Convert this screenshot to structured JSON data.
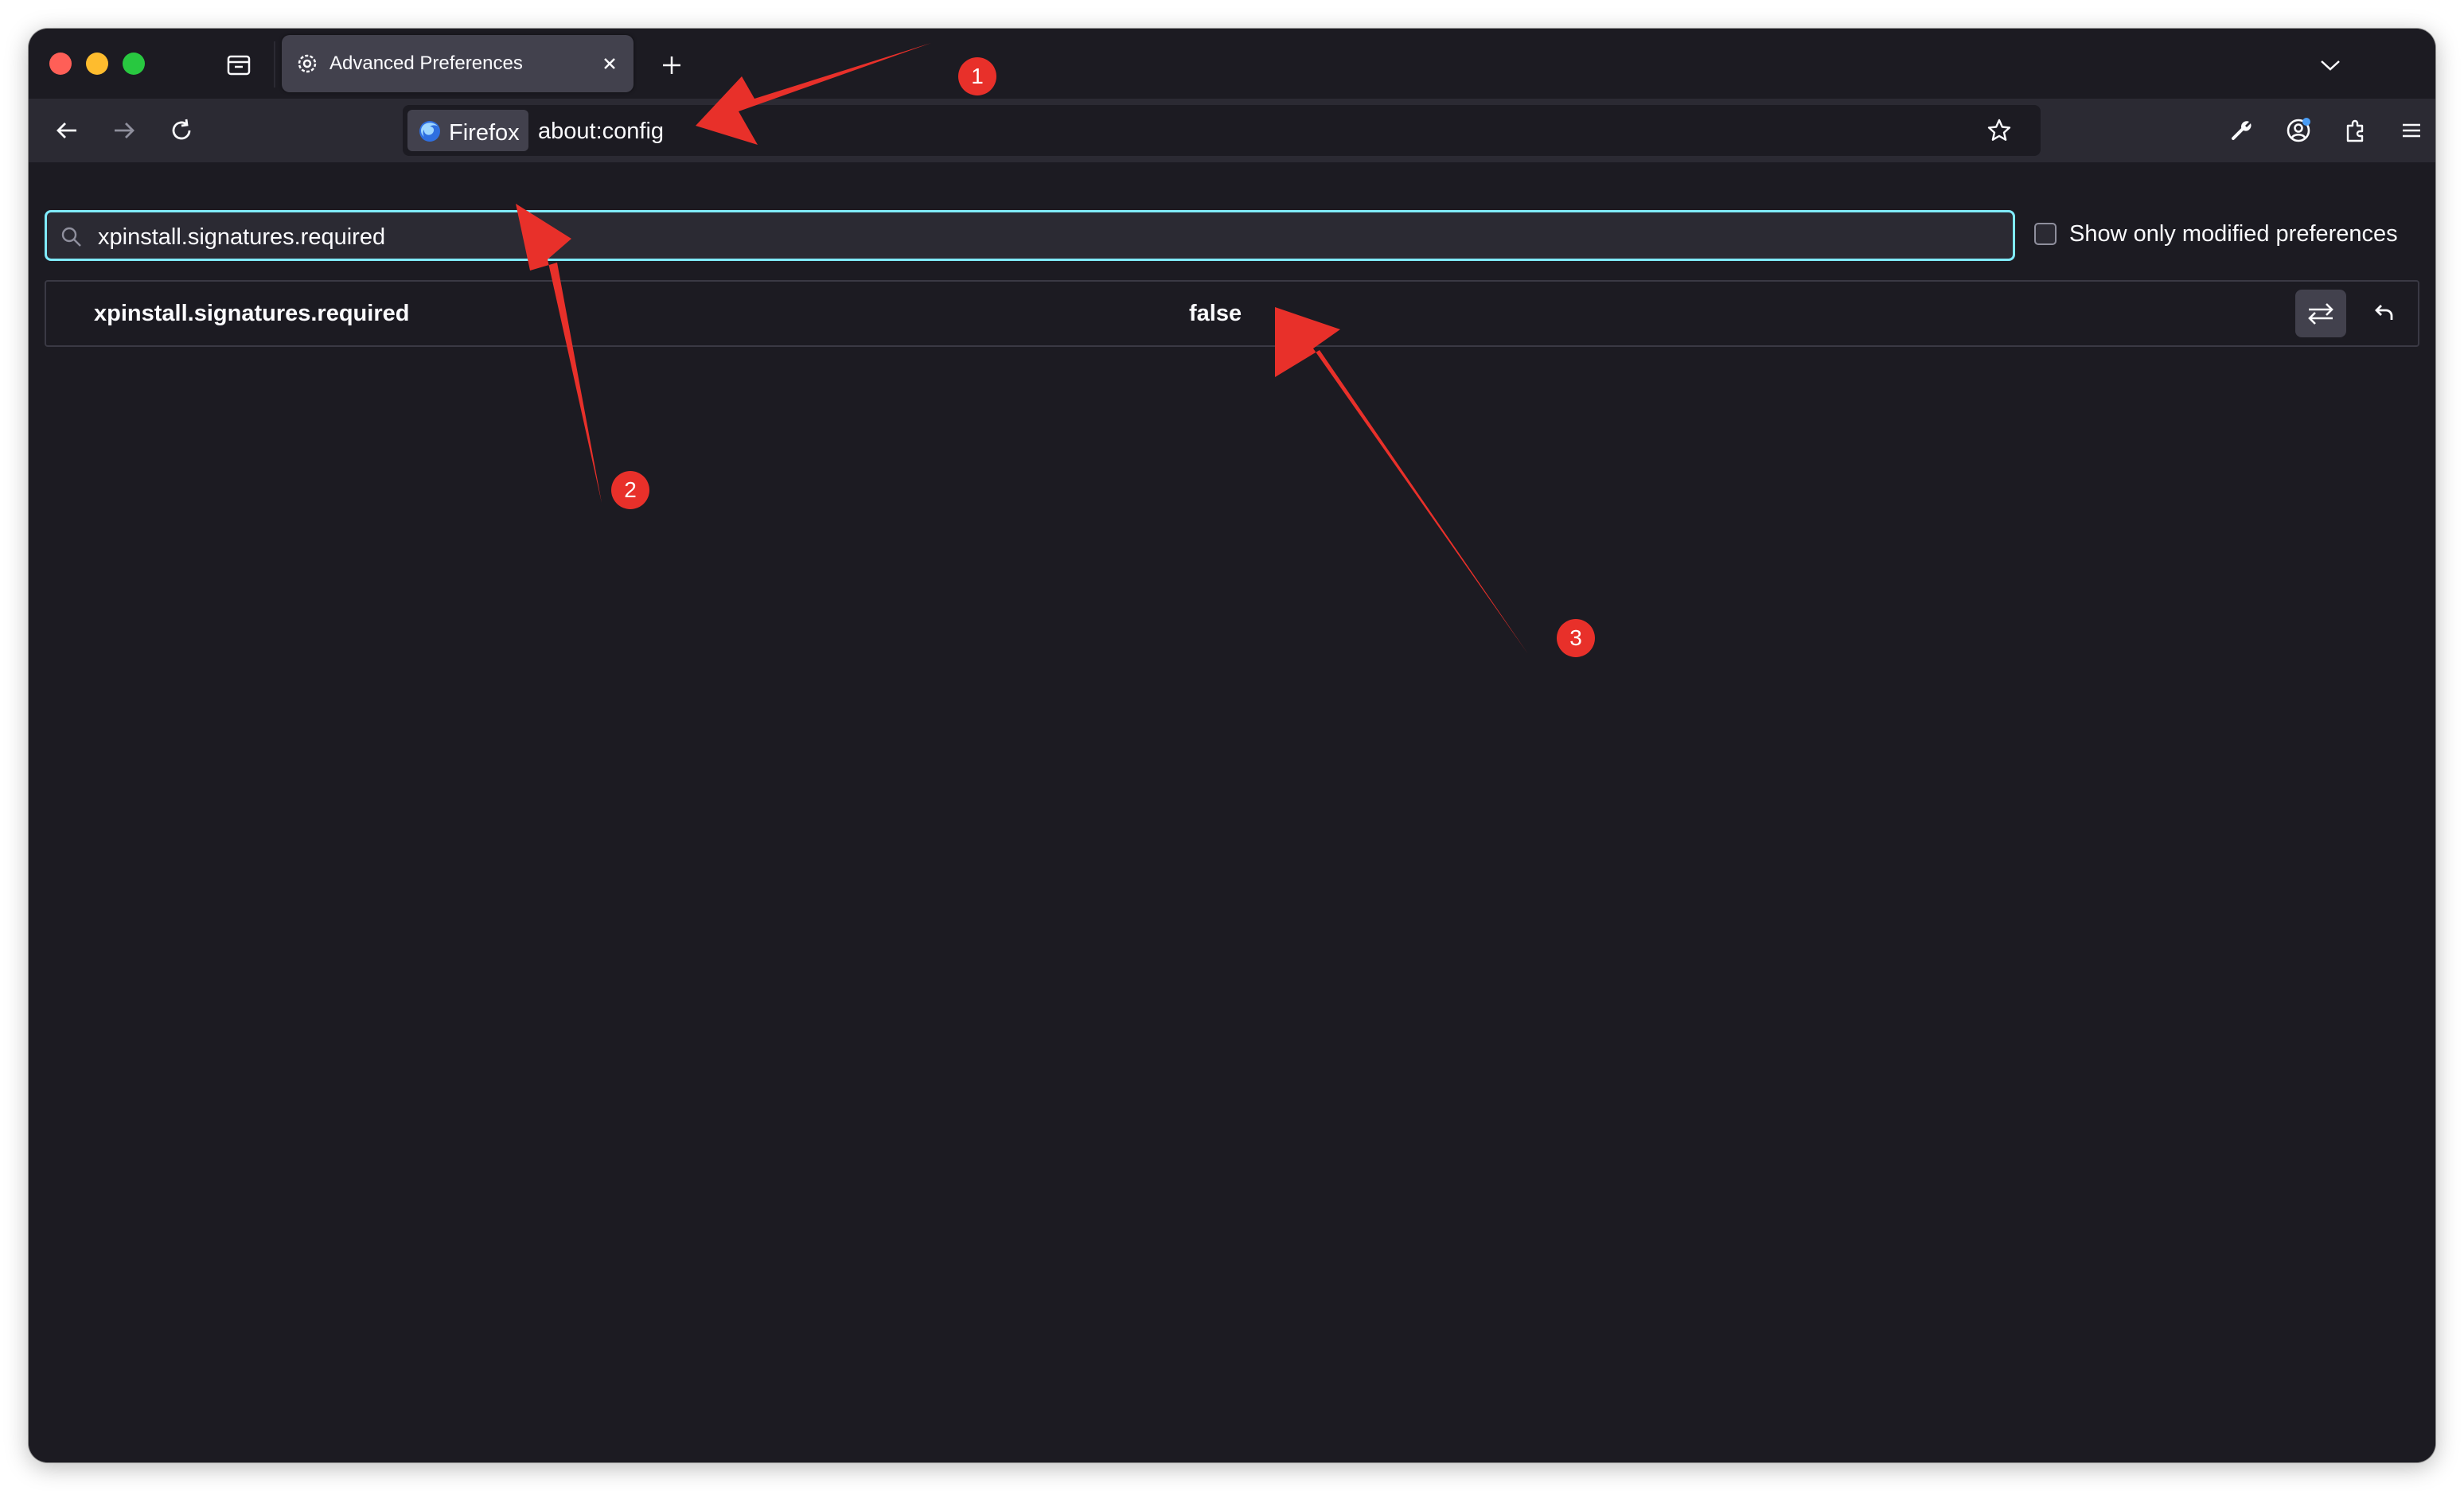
{
  "browser": {
    "tab": {
      "title": "Advanced Preferences"
    },
    "urlbar": {
      "identity_label": "Firefox",
      "url": "about:config"
    }
  },
  "search": {
    "value": "xpinstall.signatures.required"
  },
  "filter": {
    "modified_only_label": "Show only modified preferences",
    "checked": false
  },
  "preferences": [
    {
      "name": "xpinstall.signatures.required",
      "value": "false"
    }
  ],
  "annotations": [
    {
      "number": "1"
    },
    {
      "number": "2"
    },
    {
      "number": "3"
    }
  ],
  "colors": {
    "accent": "#80ebff",
    "annotation": "#e8302a",
    "background": "#1c1b22"
  },
  "icons": [
    "tab-list-icon",
    "settings-gear-icon",
    "close-icon",
    "plus-icon",
    "chevron-down-icon",
    "back-arrow-icon",
    "forward-arrow-icon",
    "reload-icon",
    "firefox-logo-icon",
    "star-icon",
    "wrench-icon",
    "account-icon",
    "extensions-icon",
    "hamburger-menu-icon",
    "search-icon",
    "toggle-icon",
    "reset-icon"
  ]
}
